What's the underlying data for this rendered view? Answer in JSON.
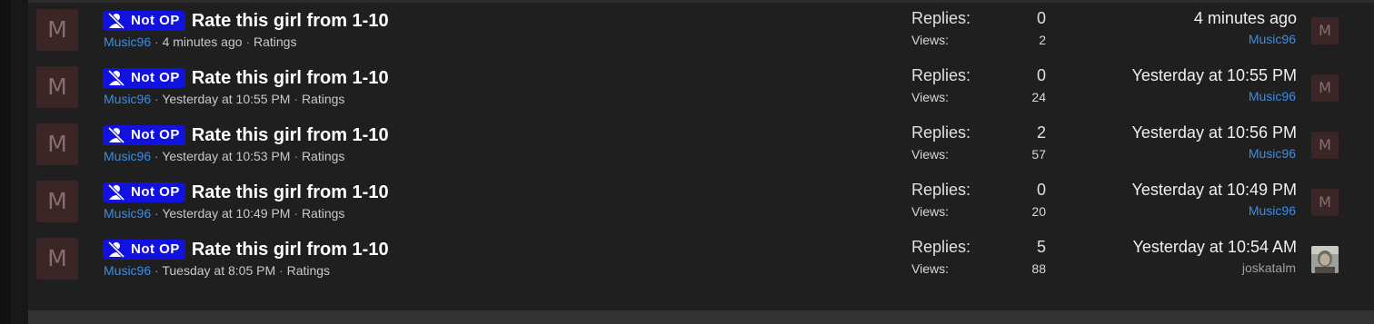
{
  "labels": {
    "badge": "Not OP",
    "replies": "Replies:",
    "views": "Views:",
    "separator": "·"
  },
  "threads": [
    {
      "avatar_letter": "M",
      "title": "Rate this girl from 1-10",
      "author": "Music96",
      "posted": "4 minutes ago",
      "forum": "Ratings",
      "replies": "0",
      "views": "2",
      "last_time": "4 minutes ago",
      "last_user": "Music96",
      "last_avatar_letter": "M"
    },
    {
      "avatar_letter": "M",
      "title": "Rate this girl from 1-10",
      "author": "Music96",
      "posted": "Yesterday at 10:55 PM",
      "forum": "Ratings",
      "replies": "0",
      "views": "24",
      "last_time": "Yesterday at 10:55 PM",
      "last_user": "Music96",
      "last_avatar_letter": "M"
    },
    {
      "avatar_letter": "M",
      "title": "Rate this girl from 1-10",
      "author": "Music96",
      "posted": "Yesterday at 10:53 PM",
      "forum": "Ratings",
      "replies": "2",
      "views": "57",
      "last_time": "Yesterday at 10:56 PM",
      "last_user": "Music96",
      "last_avatar_letter": "M"
    },
    {
      "avatar_letter": "M",
      "title": "Rate this girl from 1-10",
      "author": "Music96",
      "posted": "Yesterday at 10:49 PM",
      "forum": "Ratings",
      "replies": "0",
      "views": "20",
      "last_time": "Yesterday at 10:49 PM",
      "last_user": "Music96",
      "last_avatar_letter": "M"
    },
    {
      "avatar_letter": "M",
      "title": "Rate this girl from 1-10",
      "author": "Music96",
      "posted": "Tuesday at 8:05 PM",
      "forum": "Ratings",
      "replies": "5",
      "views": "88",
      "last_time": "Yesterday at 10:54 AM",
      "last_user": "joskatalm",
      "last_avatar_letter": ""
    }
  ],
  "icons": {
    "badge": "user-slash-icon",
    "last_avatar_5": "photo-avatar"
  },
  "colors": {
    "badge_bg": "#1212e0",
    "link": "#3a8ee6",
    "avatar_bg": "#3a2626"
  }
}
